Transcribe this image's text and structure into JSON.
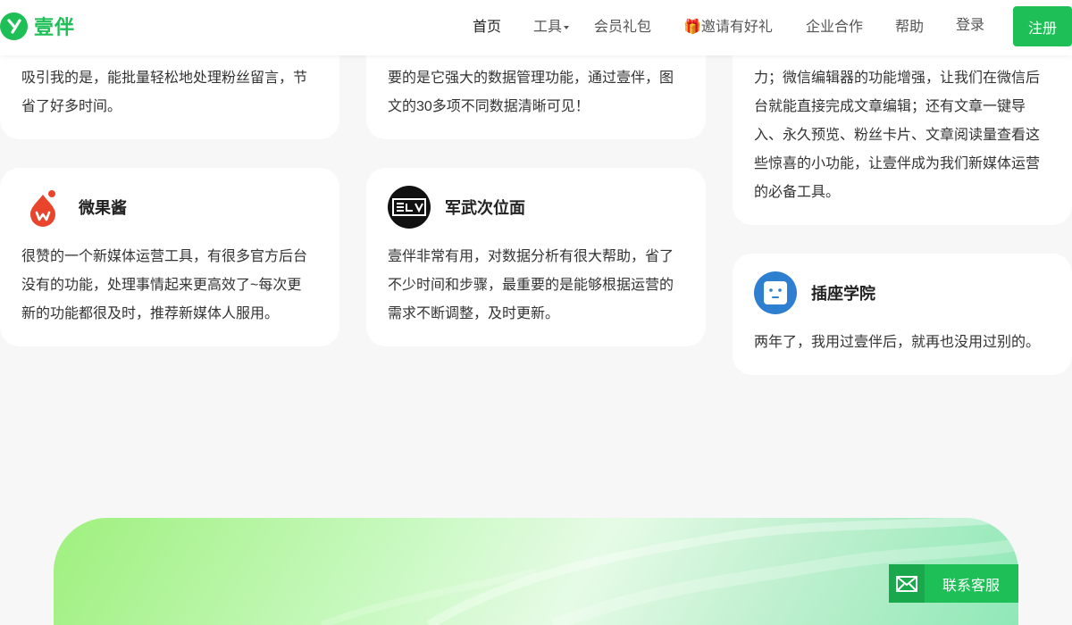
{
  "brand": {
    "name": "壹伴",
    "color": "#1fbf57"
  },
  "nav": {
    "items": [
      {
        "label": "首页",
        "active": true
      },
      {
        "label": "工具",
        "dropdown": true
      },
      {
        "label": "会员礼包"
      },
      {
        "label": "🎁邀请有好礼"
      },
      {
        "label": "企业合作"
      },
      {
        "label": "帮助"
      }
    ],
    "login": "登录",
    "register": "注册"
  },
  "testimonials": {
    "col1_top": {
      "line1": "吸引我的是，能批量轻松地处理粉丝留言，节",
      "line2": "省了好多时间。"
    },
    "col2_top": {
      "line1": "要的是它强大的数据管理功能，通过壹伴，图",
      "line2": "文的30多项不同数据清晰可见！"
    },
    "col3_top": {
      "line1": "力；微信编辑器的功能增强，让我们在微信后",
      "line2": "台就能直接完成文章编辑；还有文章一键导",
      "line3": "入、永久预览、粉丝卡片、文章阅读量查看这",
      "line4": "些惊喜的小功能，让壹伴成为我们新媒体运营",
      "line5": "的必备工具。"
    },
    "weiguojiang": {
      "name": "微果酱",
      "line1": "很赞的一个新媒体运营工具，有很多官方后台",
      "line2": "没有的功能，处理事情起来更高效了~每次更",
      "line3": "新的功能都很及时，推荐新媒体人服用。"
    },
    "junwu": {
      "name": "军武次位面",
      "line1": "壹伴非常有用，对数据分析有很大帮助，省了",
      "line2": "不少时间和步骤，最重要的是能够根据运营的",
      "line3": "需求不断调整，及时更新。"
    },
    "chazuo": {
      "name": "插座学院",
      "line1": "两年了，我用过壹伴后，就再也没用过别的。"
    }
  },
  "contact": {
    "label": "联系客服"
  }
}
